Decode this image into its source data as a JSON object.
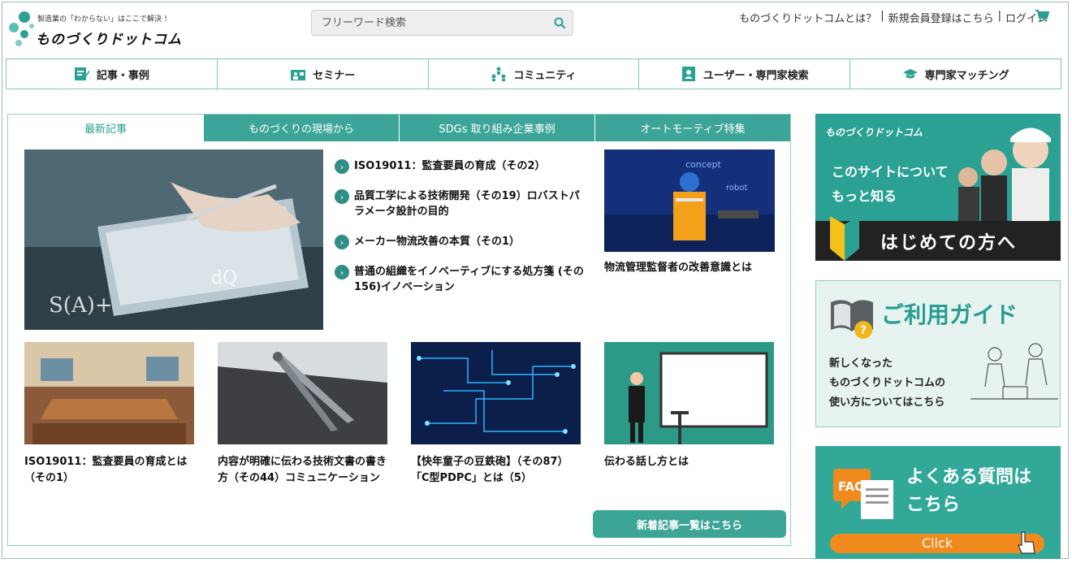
{
  "header": {
    "logo_tagline": "製造業の「わからない」はここで解決 ！",
    "logo_name": "ものづくりドットコム",
    "search_placeholder": "フリーワード検索",
    "links": [
      "ものづくりドットコムとは？",
      "新規会員登録はこちら",
      "ログイン"
    ],
    "separator": "|"
  },
  "nav": [
    {
      "label": "記事・事例",
      "icon": "article-icon"
    },
    {
      "label": "セミナー",
      "icon": "seminar-icon"
    },
    {
      "label": "コミュニティ",
      "icon": "community-icon"
    },
    {
      "label": "ユーザー・専門家検索",
      "icon": "user-search-icon"
    },
    {
      "label": "専門家マッチング",
      "icon": "graduation-cap-icon"
    }
  ],
  "tabs": [
    "最新記事",
    "ものづくりの現場から",
    "SDGs 取り組み企業事例",
    "オートモーティブ特集"
  ],
  "featured_list": [
    "ISO19011：監査要員の育成（その2）",
    "品質工学による技術開発（その19）ロバストパラメータ設計の目的",
    "メーカー物流改善の本質（その1）",
    "普通の組織をイノベーティブにする処方箋 (その156)イノベーション"
  ],
  "side_article": {
    "title": "物流管理監督者の改善意識とは"
  },
  "cards": [
    {
      "title": "ISO19011：監査要員の育成とは（その1）"
    },
    {
      "title": "内容が明確に伝わる技術文書の書き方（その44）コミュニケーション"
    },
    {
      "title": "【快年童子の豆鉄砲】（その87）「C型PDPC」とは（5）"
    },
    {
      "title": "伝わる話し方とは"
    }
  ],
  "more_button": "新着記事一覧はこちら",
  "banners": {
    "b1": {
      "logo": "ものづくりドットコム",
      "line1": "このサイトについて",
      "line2": "もっと知る",
      "cta": "はじめての方へ"
    },
    "b2": {
      "title": "ご利用ガイド",
      "lines": [
        "新しくなった",
        "ものづくりドットコムの",
        "使い方についてはこちら"
      ]
    },
    "b3": {
      "badge": "FAQ",
      "line1": "よくある質問は",
      "line2": "こちら",
      "click": "Click"
    }
  },
  "colors": {
    "accent": "#3da598",
    "accent_dark": "#2a9d8f",
    "orange": "#f08a1c"
  }
}
